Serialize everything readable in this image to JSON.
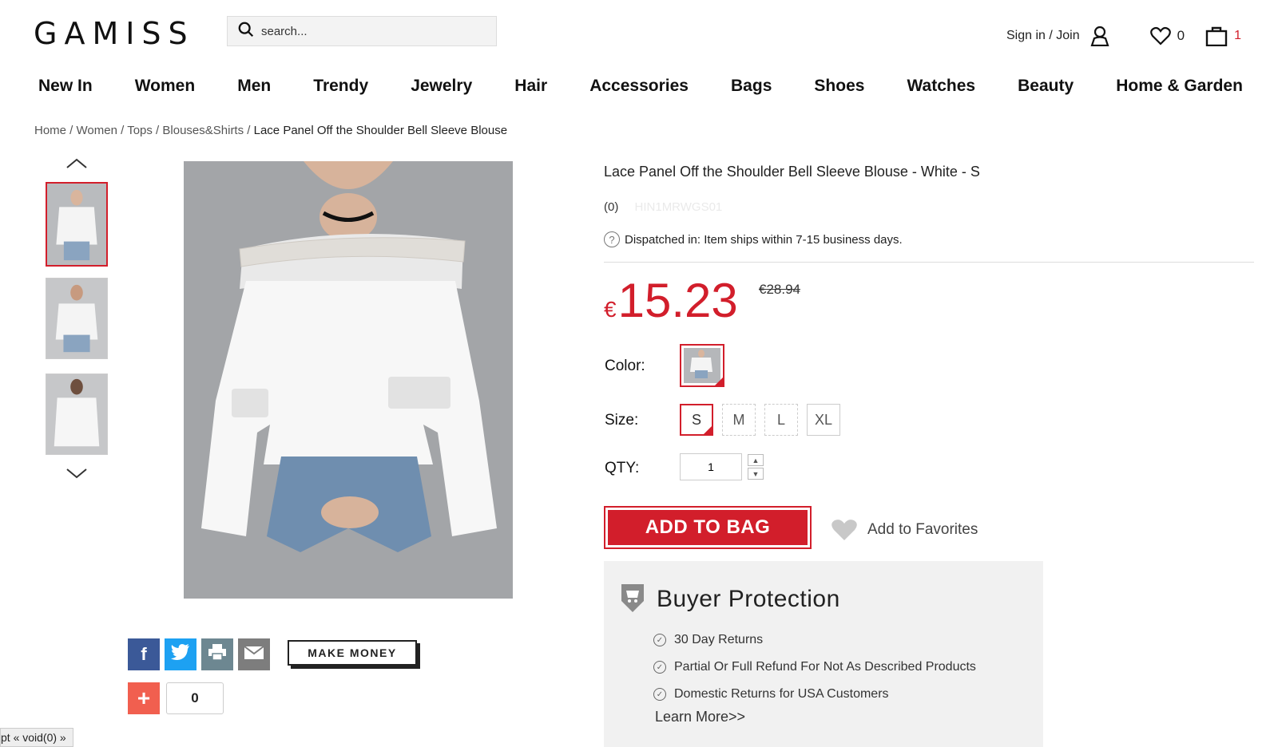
{
  "header": {
    "logo": "GAMISS",
    "search_placeholder": "search...",
    "signin": "Sign in / Join",
    "favorites_count": "0",
    "bag_count": "1"
  },
  "nav": [
    "New In",
    "Women",
    "Men",
    "Trendy",
    "Jewelry",
    "Hair",
    "Accessories",
    "Bags",
    "Shoes",
    "Watches",
    "Beauty",
    "Home & Garden"
  ],
  "breadcrumb": {
    "items": [
      "Home",
      "Women",
      "Tops",
      "Blouses&Shirts"
    ],
    "current": "Lace Panel Off the Shoulder Bell Sleeve Blouse"
  },
  "product": {
    "title": "Lace Panel Off the Shoulder Bell Sleeve Blouse - White - S",
    "reviews": "(0)",
    "sku": "HIN1MRWGS01",
    "dispatch": "Dispatched in: Item ships within 7-15 business days.",
    "currency": "€",
    "price": "15.23",
    "old_price": "€28.94",
    "color_label": "Color:",
    "size_label": "Size:",
    "sizes": [
      "S",
      "M",
      "L",
      "XL"
    ],
    "qty_label": "QTY:",
    "qty_value": "1",
    "add_to_bag": "ADD TO BAG",
    "add_to_favorites": "Add to Favorites"
  },
  "protection": {
    "title": "Buyer Protection",
    "items": [
      "30 Day Returns",
      "Partial Or Full Refund For Not As Described Products",
      "Domestic Returns for USA Customers"
    ],
    "learn_more": "Learn More>>"
  },
  "share": {
    "make_money": "MAKE MONEY",
    "plus_count": "0"
  },
  "status_bar": "pt « void(0) »",
  "colors": {
    "accent": "#d21e2b",
    "facebook": "#3b5998",
    "twitter": "#1da1f2",
    "print": "#6d8791",
    "email": "#7d7d7d",
    "plus": "#f15f4f"
  }
}
